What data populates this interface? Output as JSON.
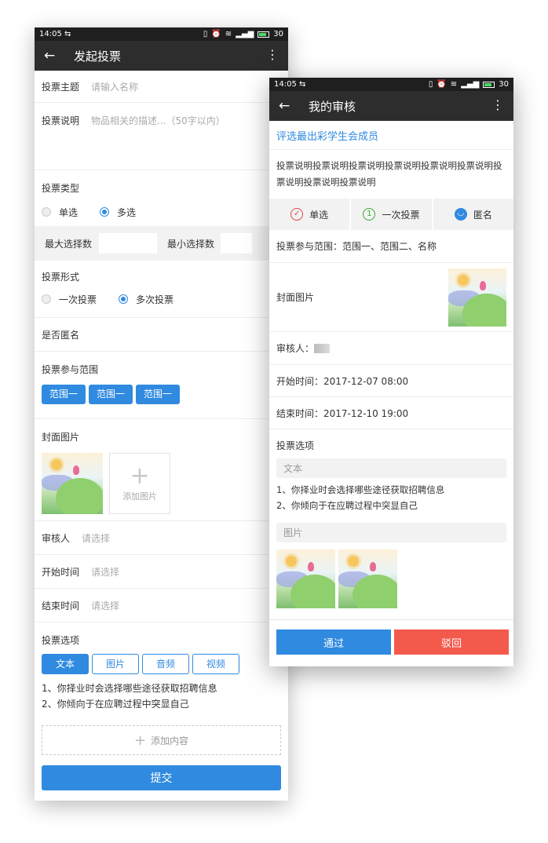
{
  "status": {
    "time": "14:05",
    "battery": "30"
  },
  "left": {
    "title": "发起投票",
    "topic_label": "投票主题",
    "topic_placeholder": "请输入名称",
    "desc_label": "投票说明",
    "desc_placeholder": "物品相关的描述...（50字以内）",
    "type_label": "投票类型",
    "type_options": [
      "单选",
      "多选"
    ],
    "max_label": "最大选择数",
    "min_label": "最小选择数",
    "form_label": "投票形式",
    "form_options": [
      "一次投票",
      "多次投票"
    ],
    "anonymous_label": "是否匿名",
    "scope_label": "投票参与范围",
    "scope_tags": [
      "范围一",
      "范围一",
      "范围一"
    ],
    "cover_label": "封面图片",
    "add_image_label": "添加图片",
    "reviewer_label": "审核人",
    "reviewer_placeholder": "请选择",
    "start_label": "开始时间",
    "start_placeholder": "请选择",
    "end_label": "结束时间",
    "end_placeholder": "请选择",
    "options_label": "投票选项",
    "option_types": [
      "文本",
      "图片",
      "音频",
      "视频"
    ],
    "option_items": [
      "1、你择业时会选择哪些途径获取招聘信息",
      "2、你倾向于在应聘过程中突显自己"
    ],
    "add_content_label": "添加内容",
    "submit_label": "提交"
  },
  "right": {
    "title": "我的审核",
    "vote_title": "评选最出彩学生会成员",
    "vote_desc": "投票说明投票说明投票说明投票说明投票说明投票说明投票说明投票说明投票说明",
    "features": [
      "单选",
      "一次投票",
      "匿名"
    ],
    "scope_text": "投票参与范围：范围一、范围二、名称",
    "cover_label": "封面图片",
    "reviewer_label": "审核人：",
    "start_text": "开始时间：2017-12-07 08:00",
    "end_text": "结束时间：2017-12-10 19:00",
    "options_label": "投票选项",
    "text_section": "文本",
    "option_items": [
      "1、你择业时会选择哪些途径获取招聘信息",
      "2、你倾向于在应聘过程中突显自己"
    ],
    "image_section": "图片",
    "pass_label": "通过",
    "reject_label": "驳回"
  },
  "colors": {
    "primary": "#2f8ae0",
    "danger": "#f35a4c",
    "appbar": "#2d2d2d"
  }
}
